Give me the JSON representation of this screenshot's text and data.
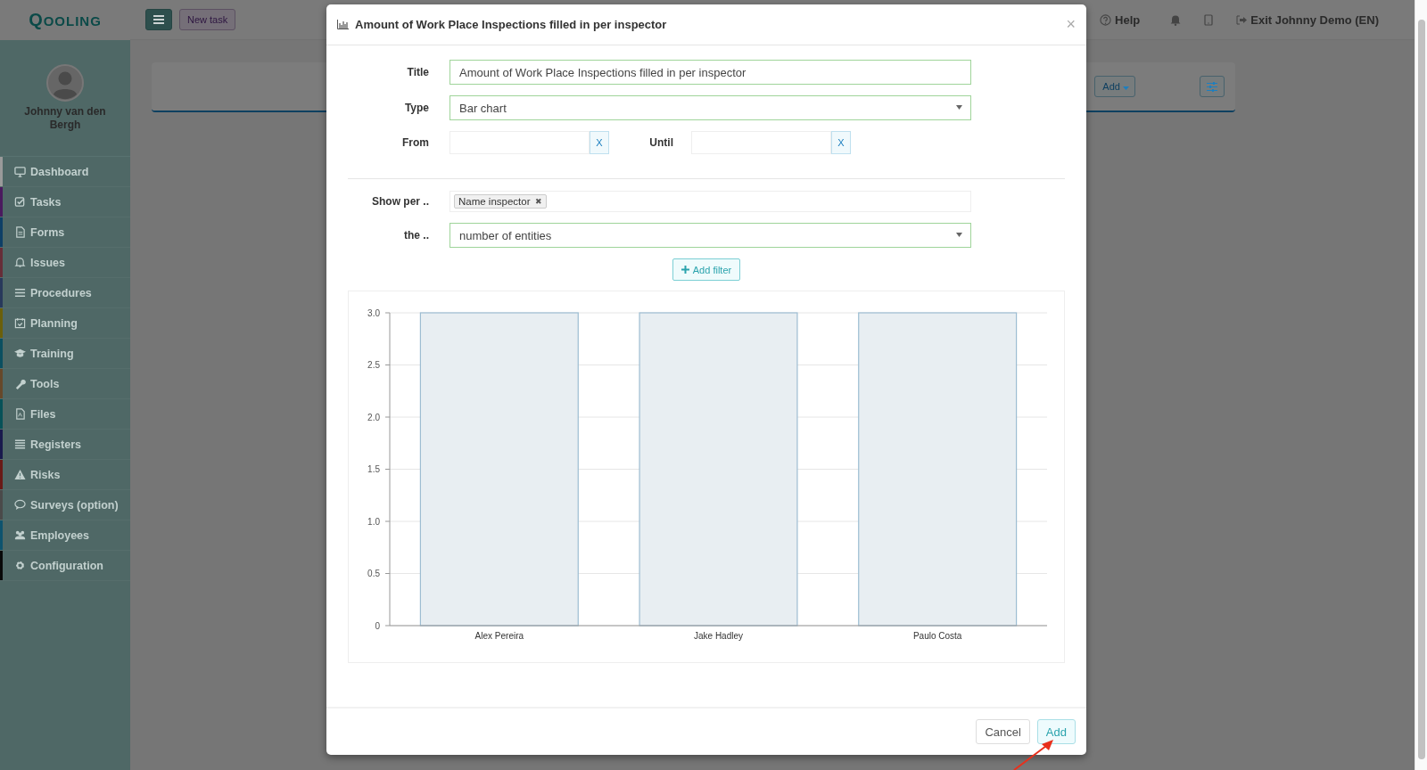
{
  "sidebar": {
    "logo": "QOOLING",
    "user": {
      "name": "Johnny van den Bergh"
    },
    "items": [
      {
        "label": "Dashboard",
        "color": "#9a9a9a"
      },
      {
        "label": "Tasks",
        "color": "#4a1a5e"
      },
      {
        "label": "Forms",
        "color": "#0e3f66"
      },
      {
        "label": "Issues",
        "color": "#662d38"
      },
      {
        "label": "Procedures",
        "color": "#28395b"
      },
      {
        "label": "Planning",
        "color": "#6b5f0a"
      },
      {
        "label": "Training",
        "color": "#0b4f60"
      },
      {
        "label": "Tools",
        "color": "#66482a"
      },
      {
        "label": "Files",
        "color": "#075158"
      },
      {
        "label": "Registers",
        "color": "#191a4d"
      },
      {
        "label": "Risks",
        "color": "#691a17"
      },
      {
        "label": "Surveys (option)",
        "color": "#4a4a4a"
      },
      {
        "label": "Employees",
        "color": "#0e536e"
      },
      {
        "label": "Configuration",
        "color": "#090909"
      }
    ]
  },
  "header": {
    "new_task": "New task",
    "help": "Help",
    "exit": "Exit Johnny Demo (EN)"
  },
  "panel": {
    "add_button": "Add"
  },
  "modal": {
    "title": "Amount of Work Place Inspections filled in per inspector",
    "close": "×",
    "form": {
      "title": {
        "label": "Title",
        "value": "Amount of Work Place Inspections filled in per inspector"
      },
      "type": {
        "label": "Type",
        "value": "Bar chart"
      },
      "from": {
        "label": "From",
        "clear": "X"
      },
      "until": {
        "label": "Until",
        "clear": "X"
      },
      "show_per": {
        "label": "Show per ..",
        "tags": [
          {
            "label": "Name inspector",
            "remove": "✖"
          }
        ]
      },
      "the": {
        "label": "the ..",
        "value": "number of entities"
      },
      "add_filter": "Add filter"
    },
    "chart_data": {
      "type": "bar",
      "grid": true,
      "categories": [
        "Alex Pereira",
        "Jake Hadley",
        "Paulo Costa"
      ],
      "values": [
        3,
        3,
        3
      ],
      "ylim": [
        0,
        3
      ],
      "yticks": [
        {
          "value": 0,
          "label": "0"
        },
        {
          "value": 0.5,
          "label": "0.5"
        },
        {
          "value": 1,
          "label": "1.0"
        },
        {
          "value": 1.5,
          "label": "1.5"
        },
        {
          "value": 2,
          "label": "2.0"
        },
        {
          "value": 2.5,
          "label": "2.5"
        },
        {
          "value": 3,
          "label": "3.0"
        }
      ]
    },
    "buttons": {
      "cancel": "Cancel",
      "add": "Add"
    }
  }
}
